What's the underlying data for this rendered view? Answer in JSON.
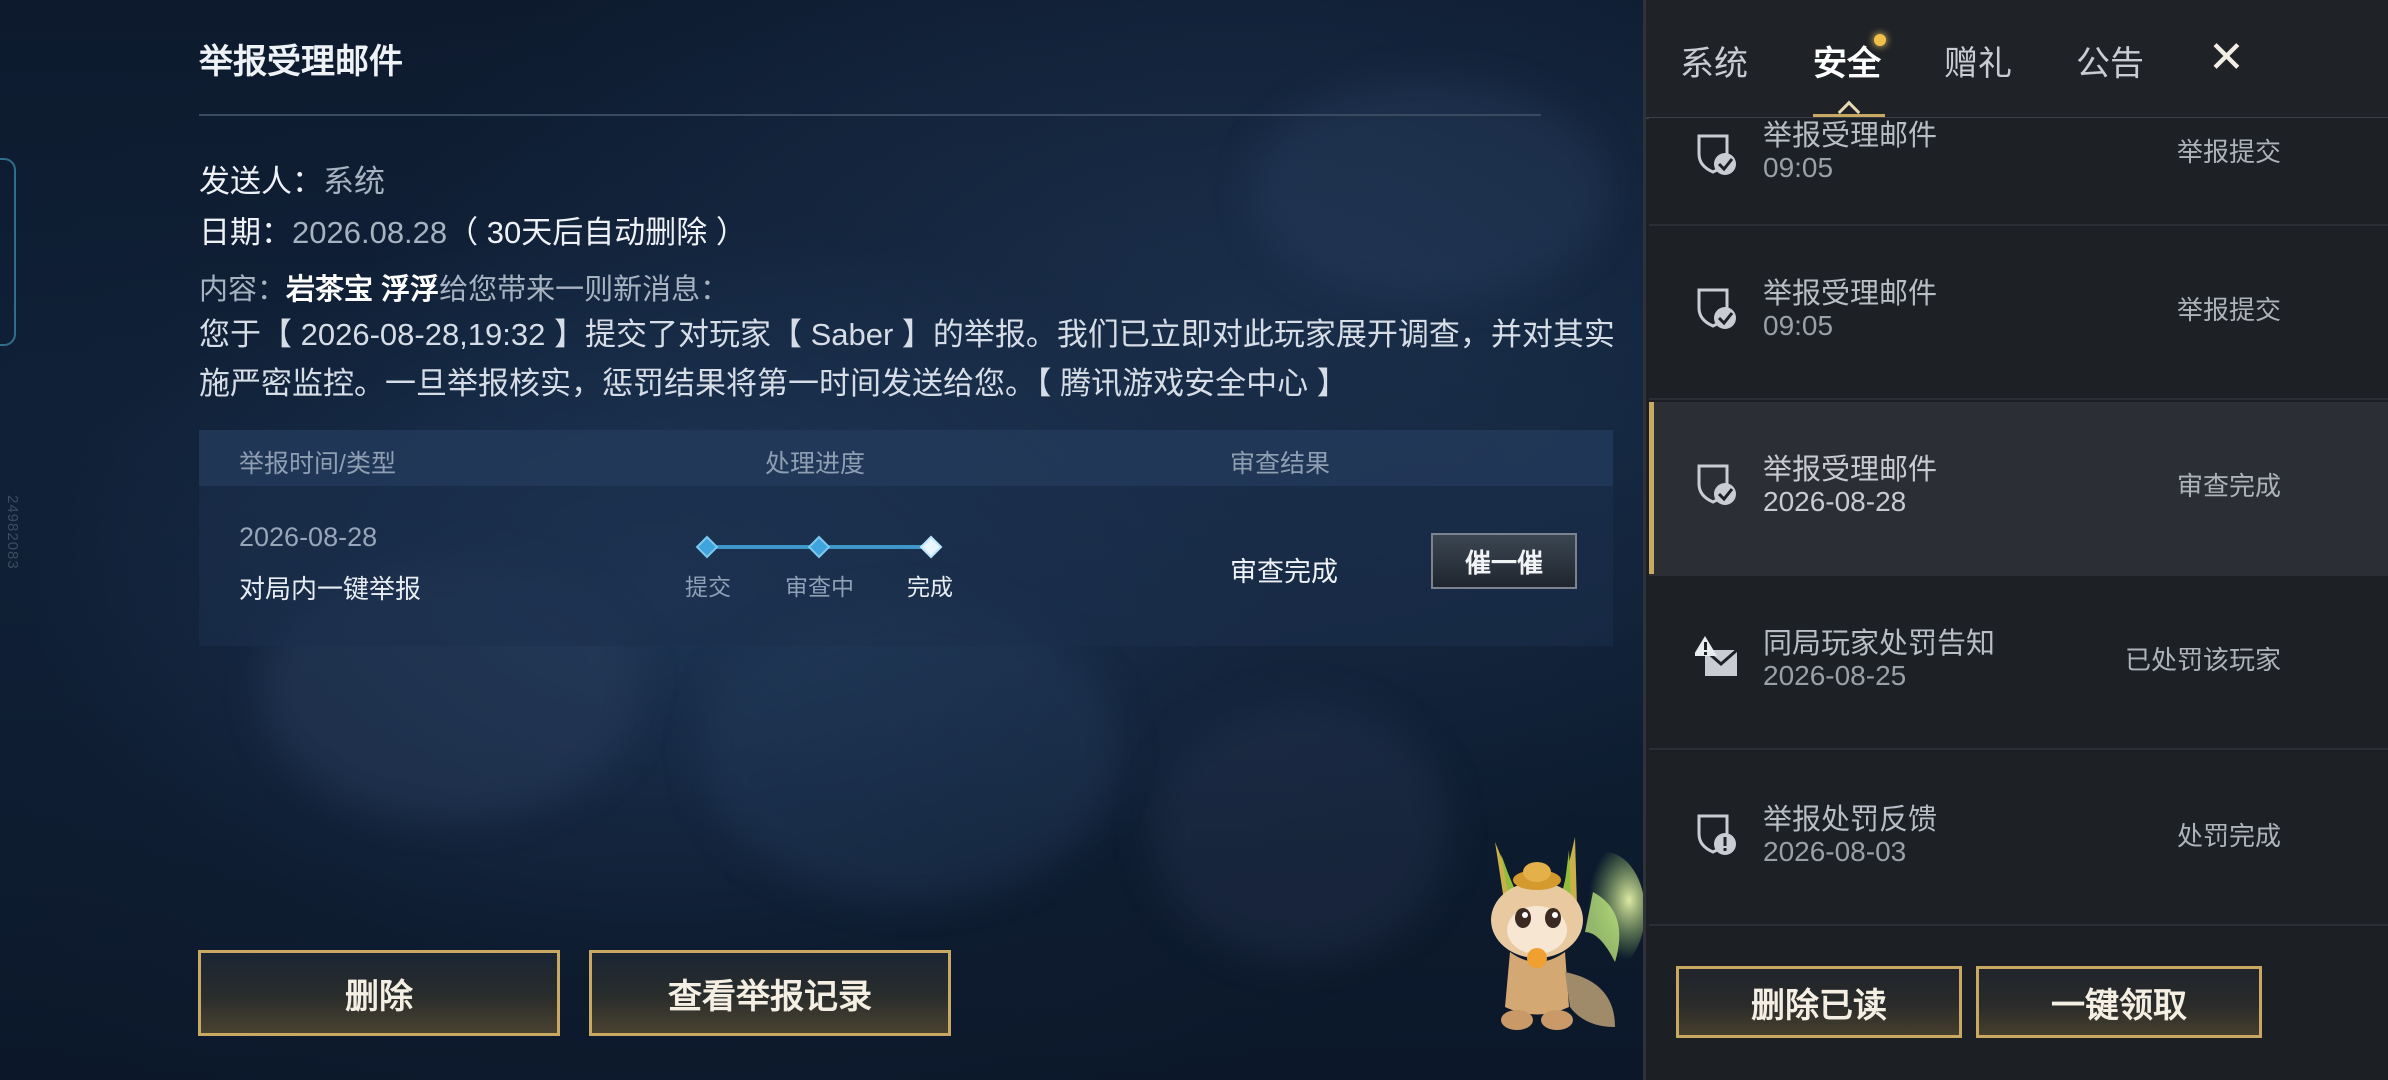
{
  "side_code": "24982083",
  "detail": {
    "title": "举报受理邮件",
    "sender_label": "发送人：",
    "sender_value": "系统",
    "date_label": "日期：",
    "date_value": "2026.08.28",
    "date_note": "（ 30天后自动删除 ）",
    "content_label": "内容：",
    "content_name": "岩茶宝 浮浮",
    "content_intro": "给您带来一则新消息：",
    "body": "您于【 2026-08-28,19:32 】提交了对玩家【 Saber 】的举报。我们已立即对此玩家展开调查，并对其实施严密监控。一旦举报核实，惩罚结果将第一时间发送给您。【 腾讯游戏安全中心 】"
  },
  "report_table": {
    "headers": [
      "举报时间/类型",
      "处理进度",
      "审查结果"
    ],
    "row": {
      "date": "2026-08-28",
      "type": "对局内一键举报",
      "progress_steps": [
        "提交",
        "审查中",
        "完成"
      ],
      "current_step": 2,
      "result": "审查完成",
      "urge_label": "催一催"
    }
  },
  "detail_buttons": {
    "delete": "删除",
    "records": "查看举报记录"
  },
  "tabs": [
    "系统",
    "安全",
    "赠礼",
    "公告"
  ],
  "active_tab": "安全",
  "close_label": "✕",
  "mail_list": [
    {
      "name": "举报受理邮件",
      "date": "09:05",
      "status": "举报提交",
      "icon": "shield-check-icon"
    },
    {
      "name": "举报受理邮件",
      "date": "09:05",
      "status": "举报提交",
      "icon": "shield-check-icon"
    },
    {
      "name": "举报受理邮件",
      "date": "2026-08-28",
      "status": "审查完成",
      "icon": "shield-check-icon",
      "selected": true
    },
    {
      "name": "同局玩家处罚告知",
      "date": "2026-08-25",
      "status": "已处罚该玩家",
      "icon": "alert-envelope-icon"
    },
    {
      "name": "举报处罚反馈",
      "date": "2026-08-03",
      "status": "处罚完成",
      "icon": "shield-alert-icon"
    }
  ],
  "list_buttons": {
    "delete_read": "删除已读",
    "claim_all": "一键领取"
  },
  "colors": {
    "accent_gold": "#c9a862",
    "progress_blue": "#3f97c9",
    "panel_dark": "#1c1f24"
  }
}
